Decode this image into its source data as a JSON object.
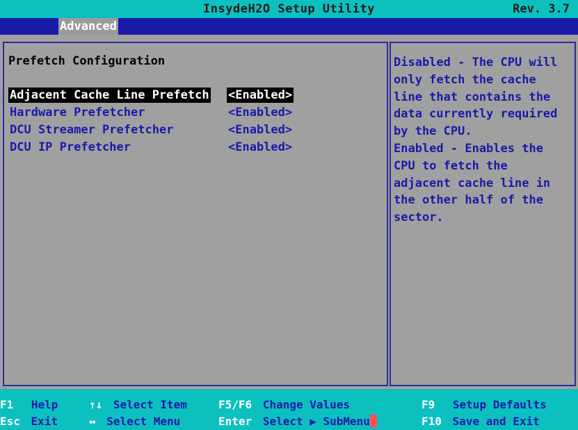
{
  "titlebar": {
    "title": "InsydeH2O Setup Utility",
    "revision": "Rev. 3.7"
  },
  "tabs": [
    {
      "label": "Advanced",
      "active": true
    }
  ],
  "main": {
    "section_title": "Prefetch Configuration",
    "items": [
      {
        "label": "Adjacent Cache Line Prefetch",
        "value": "<Enabled>",
        "selected": true
      },
      {
        "label": "Hardware Prefetcher",
        "value": "<Enabled>",
        "selected": false
      },
      {
        "label": "DCU Streamer Prefetcher",
        "value": "<Enabled>",
        "selected": false
      },
      {
        "label": "DCU IP Prefetcher",
        "value": "<Enabled>",
        "selected": false
      }
    ]
  },
  "help": {
    "lines": [
      "Disabled - The CPU will",
      "only fetch the cache",
      "line that contains the",
      "data currently required",
      "by the CPU.",
      "Enabled - Enables the",
      "CPU to fetch the",
      "adjacent cache line in",
      "the other half of the",
      "sector."
    ]
  },
  "footer": {
    "f1": {
      "key": "F1",
      "action": "Help"
    },
    "esc": {
      "key": "Esc",
      "action": "Exit"
    },
    "arrows_ud": {
      "key": "↑↓",
      "action": "Select Item"
    },
    "arrows_lr": {
      "key": "↔",
      "action": "Select Menu"
    },
    "f5f6": {
      "key": "F5/F6",
      "action": "Change Values"
    },
    "enter": {
      "key": "Enter",
      "action": "Select ▶ SubMenu"
    },
    "f9": {
      "key": "F9",
      "action": "Setup Defaults"
    },
    "f10": {
      "key": "F10",
      "action": "Save and Exit"
    }
  },
  "colors": {
    "background": "#a0a0a0",
    "title_bar": "#0cc0c0",
    "tab_bar": "#1a1aa8",
    "item_text": "#1a1aa8",
    "selection_bg": "#000000",
    "selection_fg": "#ffffff",
    "footer_key": "#ffffff"
  }
}
